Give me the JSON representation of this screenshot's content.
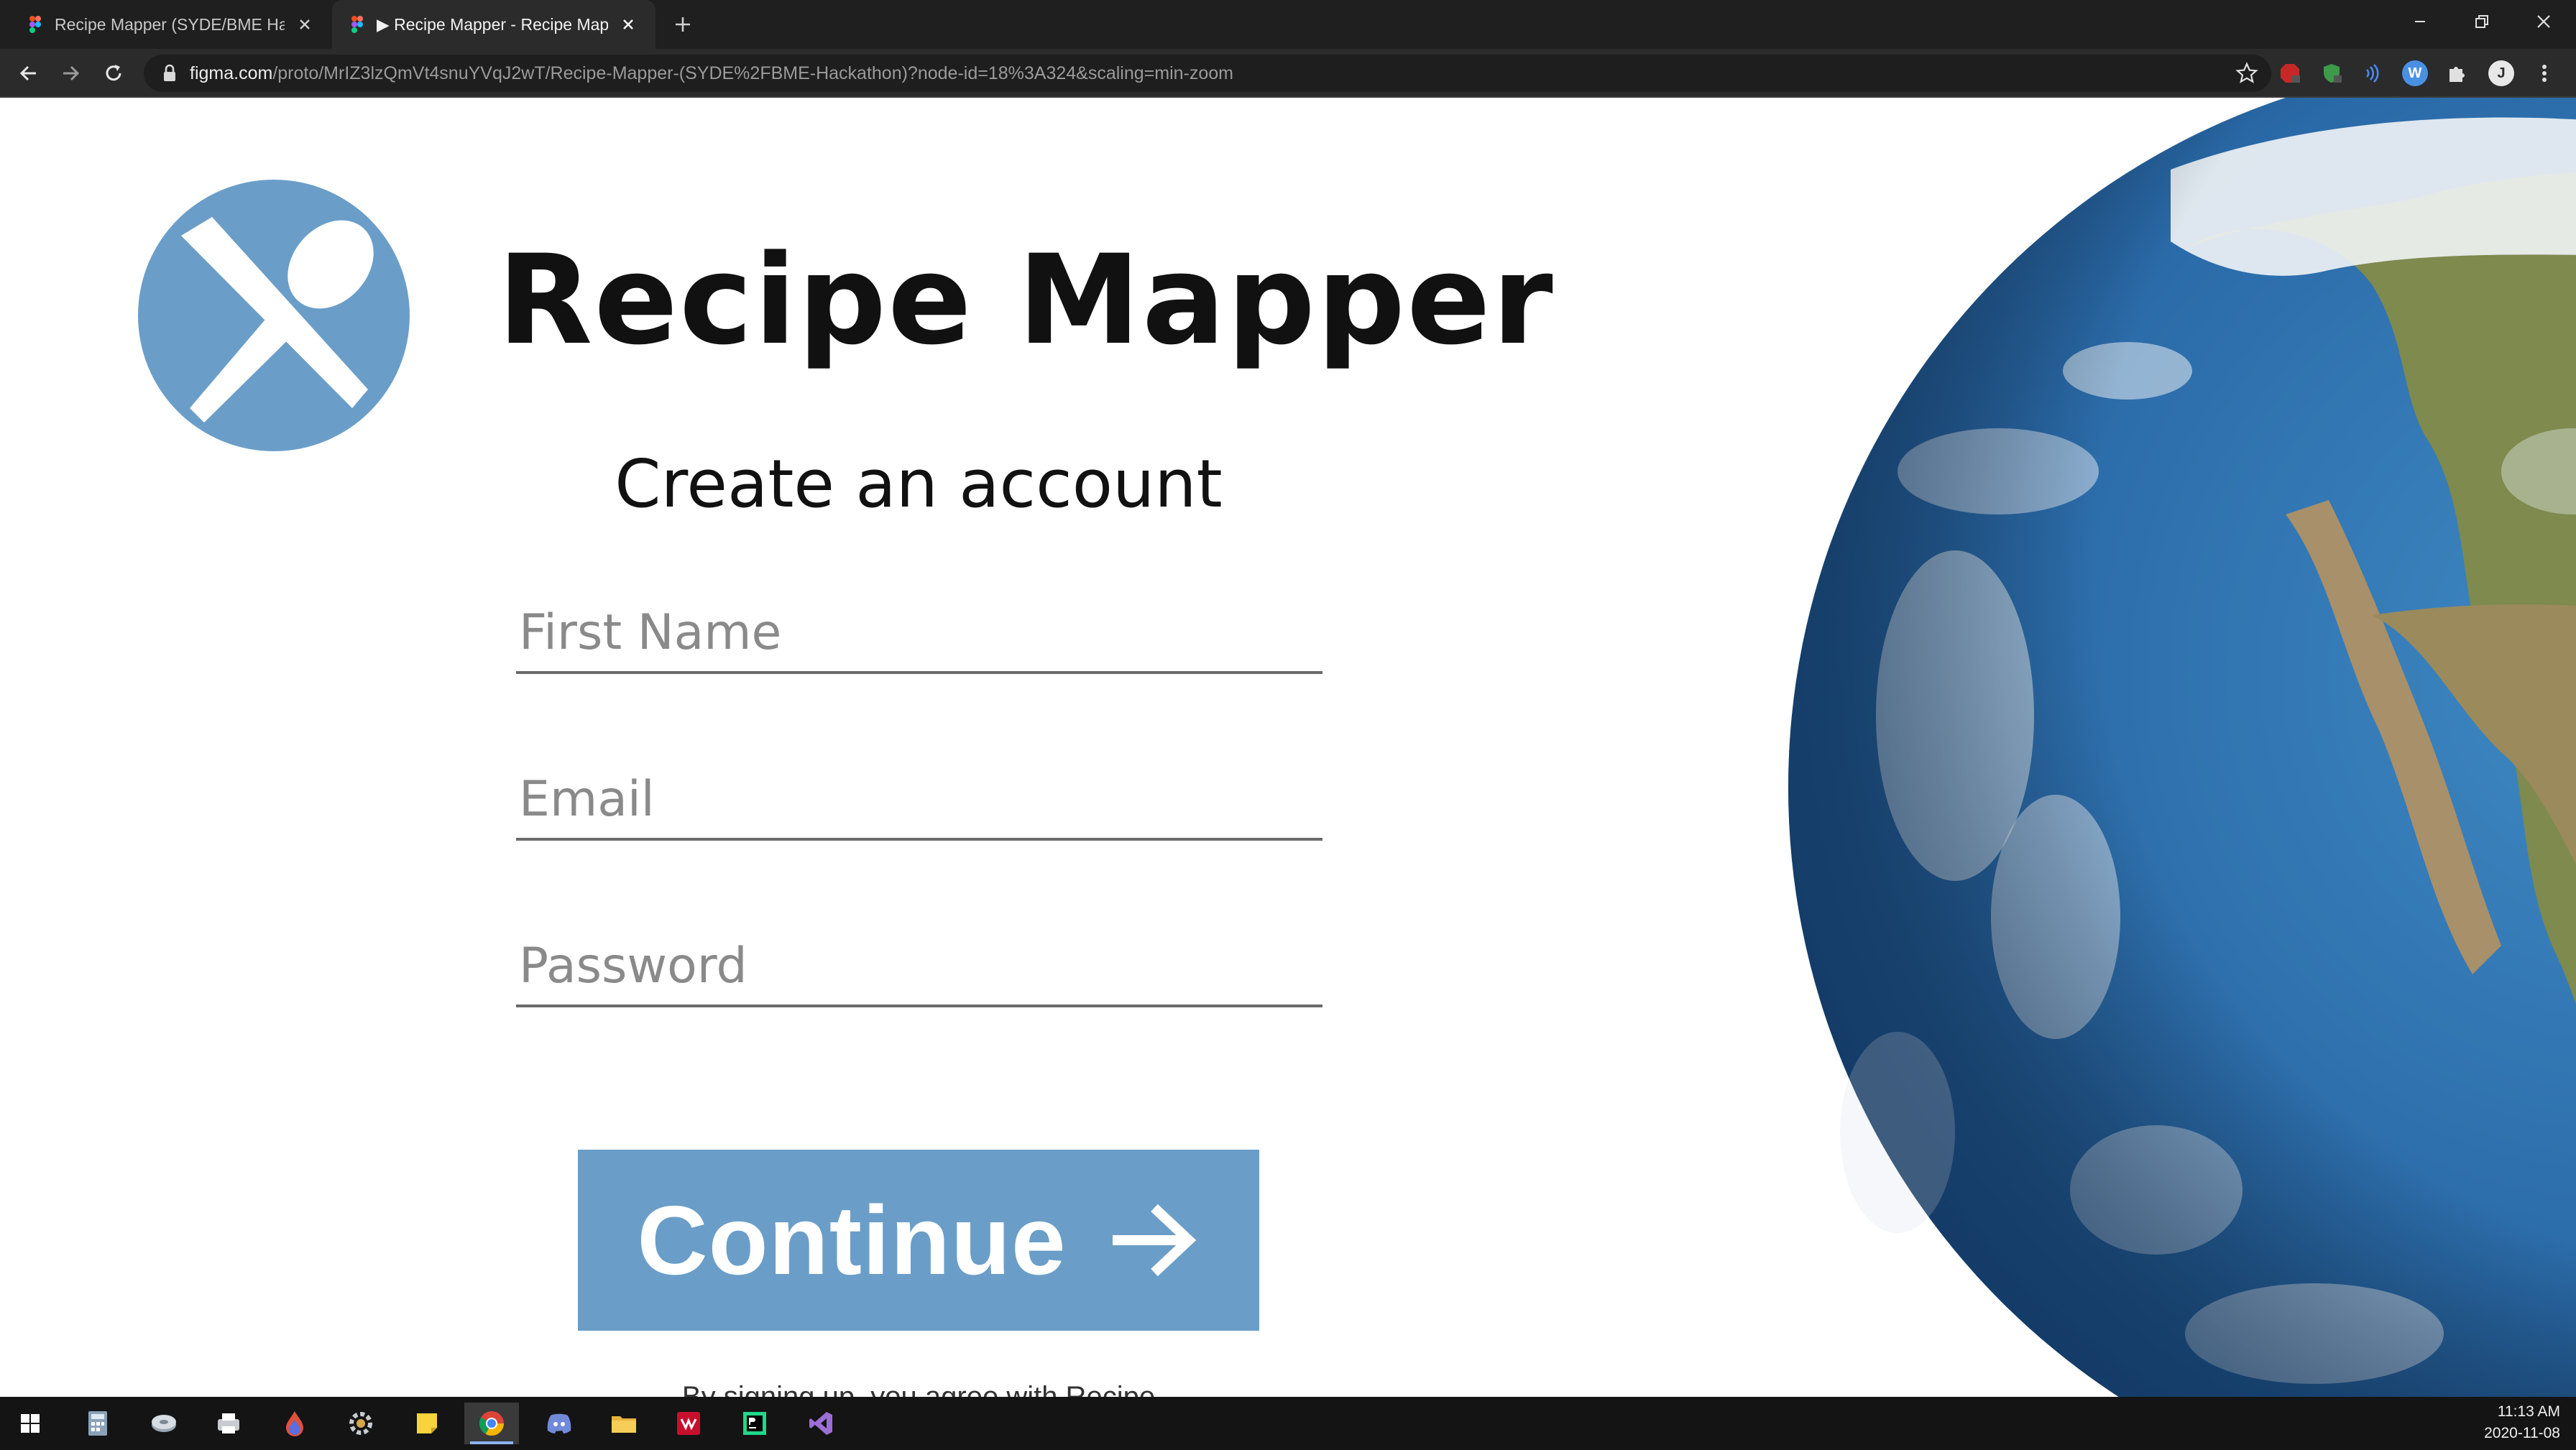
{
  "browser": {
    "tabs": [
      {
        "title": "Recipe Mapper (SYDE/BME Hack",
        "active": false
      },
      {
        "title": "▶ Recipe Mapper - Recipe Mapp",
        "active": true
      }
    ],
    "url_host": "figma.com",
    "url_path": "/proto/MrIZ3lzQmVt4snuYVqJ2wT/Recipe-Mapper-(SYDE%2FBME-Hackathon)?node-id=18%3A324&scaling=min-zoom",
    "profile_initial": "J"
  },
  "page": {
    "brand_name": "Recipe Mapper",
    "subtitle": "Create an account",
    "fields": {
      "first_name_placeholder": "First Name",
      "email_placeholder": "Email",
      "password_placeholder": "Password"
    },
    "continue_label": "Continue",
    "terms_text": "By signing up, you agree with Recipe",
    "accent_color": "#6a9ec8"
  },
  "taskbar": {
    "time": "11:13 AM",
    "date": "2020-11-08"
  }
}
